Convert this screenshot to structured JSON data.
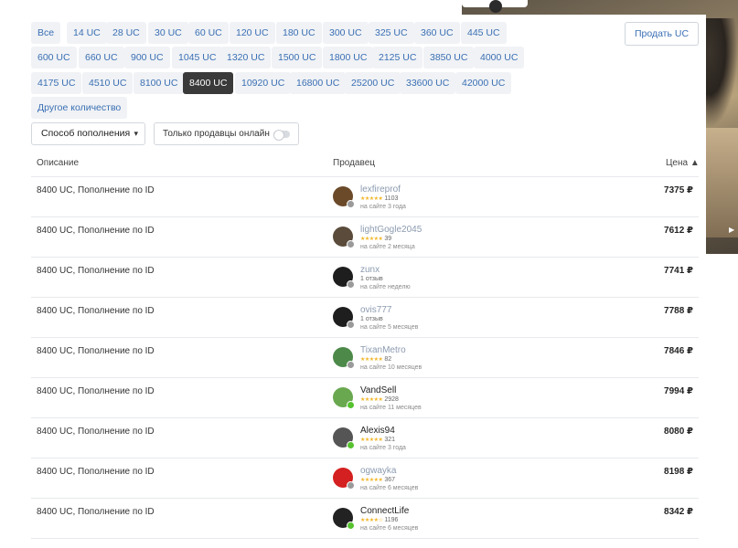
{
  "amounts": [
    "Все",
    "14 UC",
    "28 UC",
    "30 UC",
    "60 UC",
    "120 UC",
    "180 UC",
    "300 UC",
    "325 UC",
    "360 UC",
    "445 UC",
    "600 UC",
    "660 UC",
    "900 UC",
    "1045 UC",
    "1320 UC",
    "1500 UC",
    "1800 UC",
    "2125 UC",
    "3850 UC",
    "4000 UC",
    "4175 UC",
    "4510 UC",
    "8100 UC",
    "8400 UC",
    "10920 UC",
    "16800 UC",
    "25200 UC",
    "33600 UC",
    "42000 UC",
    "Другое количество"
  ],
  "active_amount": "8400 UC",
  "sell_button": "Продать UC",
  "filter": {
    "method_label": "Способ пополнения",
    "online_label": "Только продавцы онлайн"
  },
  "table": {
    "col_desc": "Описание",
    "col_seller": "Продавец",
    "col_price": "Цена ▲",
    "rows": [
      {
        "desc": "8400 UC, Пополнение по ID",
        "seller": "lexfireprof",
        "reviews": "1103",
        "stars": "★★★★★",
        "since": "на сайте 3 года",
        "price": "7375 ₽",
        "online": false,
        "avatar_color": "#6b4a2a"
      },
      {
        "desc": "8400 UC, Пополнение по ID",
        "seller": "lightGogle2045",
        "reviews": "39",
        "stars": "★★★★★",
        "since": "на сайте 2 месяца",
        "price": "7612 ₽",
        "online": false,
        "avatar_color": "#5a4b3a"
      },
      {
        "desc": "8400 UC, Пополнение по ID",
        "seller": "zunx",
        "reviews": "1 отзыв",
        "stars": "",
        "since": "на сайте неделю",
        "price": "7741 ₽",
        "online": false,
        "avatar_color": "#1e1e1e"
      },
      {
        "desc": "8400 UC, Пополнение по ID",
        "seller": "ovis777",
        "reviews": "1 отзыв",
        "stars": "",
        "since": "на сайте 5 месяцев",
        "price": "7788 ₽",
        "online": false,
        "avatar_color": "#1e1e1e"
      },
      {
        "desc": "8400 UC, Пополнение по ID",
        "seller": "TixanMetro",
        "reviews": "82",
        "stars": "★★★★★",
        "since": "на сайте 10 месяцев",
        "price": "7846 ₽",
        "online": false,
        "avatar_color": "#4d8a4a"
      },
      {
        "desc": "8400 UC, Пополнение по ID",
        "seller": "VandSell",
        "reviews": "2928",
        "stars": "★★★★★",
        "since": "на сайте 11 месяцев",
        "price": "7994 ₽",
        "online": true,
        "avatar_color": "#6aa84f"
      },
      {
        "desc": "8400 UC, Пополнение по ID",
        "seller": "Alexis94",
        "reviews": "321",
        "stars": "★★★★★",
        "since": "на сайте 3 года",
        "price": "8080 ₽",
        "online": true,
        "avatar_color": "#555555"
      },
      {
        "desc": "8400 UC, Пополнение по ID",
        "seller": "ogwayka",
        "reviews": "367",
        "stars": "★★★★★",
        "since": "на сайте 6 месяцев",
        "price": "8198 ₽",
        "online": false,
        "avatar_color": "#d42020"
      },
      {
        "desc": "8400 UC, Пополнение по ID",
        "seller": "ConnectLife",
        "reviews": "1196",
        "stars": "★★★★☆",
        "since": "на сайте 6 месяцев",
        "price": "8342 ₽",
        "online": true,
        "avatar_color": "#222222"
      }
    ]
  },
  "colors": {
    "accent": "#3a6fb4",
    "active_chip": "#3a3a3a",
    "online": "#55c22e",
    "offline": "#9a9a9a",
    "stars": "#f2b72b"
  }
}
